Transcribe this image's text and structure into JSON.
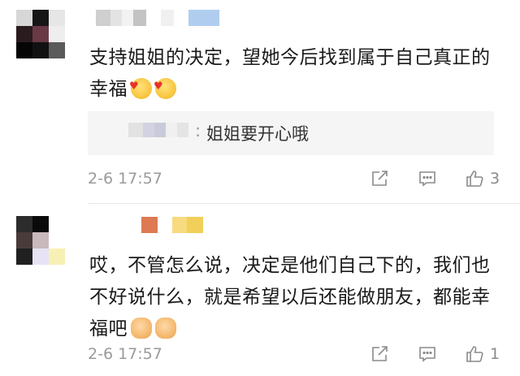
{
  "comments": [
    {
      "text": "支持姐姐的决定，望她今后找到属于自己真正的幸福",
      "emojis": [
        "face-with-hearts",
        "face-with-hearts"
      ],
      "reply": {
        "separator": ":",
        "text": "姐姐要开心哦"
      },
      "time": "2-6 17:57",
      "likes": "3"
    },
    {
      "text": "哎，不管怎么说，决定是他们自己下的，我们也不好说什么，就是希望以后还能做朋友，都能幸福吧",
      "emojis": [
        "fist-bump",
        "fist-bump"
      ],
      "time": "2-6 17:57",
      "likes": "1"
    }
  ],
  "colors": {
    "avatar1": [
      "#d7d7d7",
      "#161616",
      "#e6e6e6",
      "#2a1c1e",
      "#6a3946",
      "#eeeeee",
      "#050505",
      "#111111",
      "#5a5a5a"
    ],
    "avatar2": [
      "#2c2c2c",
      "#0a0a0a",
      "#ffffff",
      "#4a3b3b",
      "#c9b9bd",
      "#ffffff",
      "#202020",
      "#e7e2f4",
      "#f7f0b5"
    ],
    "name1": [
      "#cfcfcf",
      "#e3e3e3",
      "#f2f2f2",
      "#c3c3c3",
      "#ffffff",
      "#f0f0f0",
      "#ffffff",
      "#b0cdf0"
    ],
    "name2": [
      "#ffffff",
      "#ffffff",
      "#ffffff",
      "#ffffff",
      "#dd7a54",
      "#ffffff",
      "#f7db7e",
      "#f2cf58"
    ],
    "reply_name": [
      "#e2e2e2",
      "#d2d2e2",
      "#c9ccd8",
      "#f0f0f0",
      "#e4e4e4"
    ]
  },
  "icons": {
    "share": "share-icon",
    "reply": "comment-icon",
    "like": "thumb-up-icon"
  }
}
